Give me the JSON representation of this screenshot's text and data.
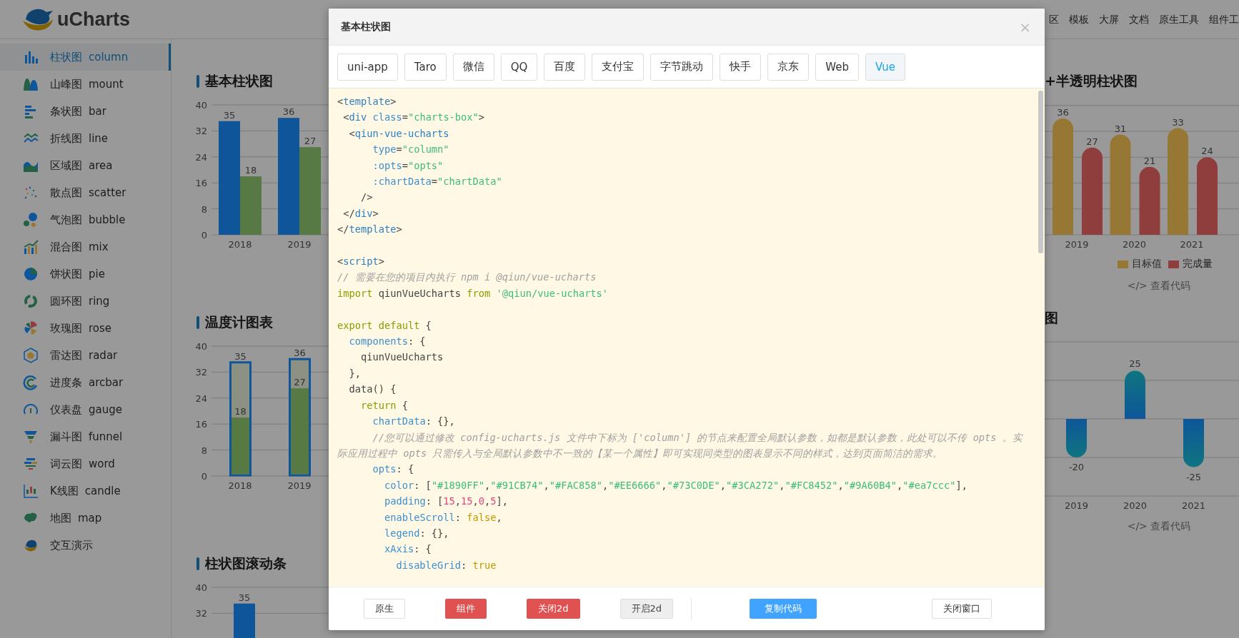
{
  "header": {
    "logo": "uCharts",
    "nav": [
      "区",
      "模板",
      "大屏",
      "文档",
      "原生工具",
      "组件工"
    ]
  },
  "sidebar": {
    "items": [
      {
        "label": "柱状图",
        "en": "column",
        "selected": true
      },
      {
        "label": "山峰图",
        "en": "mount",
        "selected": false
      },
      {
        "label": "条状图",
        "en": "bar",
        "selected": false
      },
      {
        "label": "折线图",
        "en": "line",
        "selected": false
      },
      {
        "label": "区域图",
        "en": "area",
        "selected": false
      },
      {
        "label": "散点图",
        "en": "scatter",
        "selected": false
      },
      {
        "label": "气泡图",
        "en": "bubble",
        "selected": false
      },
      {
        "label": "混合图",
        "en": "mix",
        "selected": false
      },
      {
        "label": "饼状图",
        "en": "pie",
        "selected": false
      },
      {
        "label": "圆环图",
        "en": "ring",
        "selected": false
      },
      {
        "label": "玫瑰图",
        "en": "rose",
        "selected": false
      },
      {
        "label": "雷达图",
        "en": "radar",
        "selected": false
      },
      {
        "label": "进度条",
        "en": "arcbar",
        "selected": false
      },
      {
        "label": "仪表盘",
        "en": "gauge",
        "selected": false
      },
      {
        "label": "漏斗图",
        "en": "funnel",
        "selected": false
      },
      {
        "label": "词云图",
        "en": "word",
        "selected": false
      },
      {
        "label": "K线图",
        "en": "candle",
        "selected": false
      },
      {
        "label": "地图",
        "en": "map",
        "selected": false
      },
      {
        "label": "交互演示",
        "selected": false
      }
    ]
  },
  "charts": {
    "left": [
      {
        "kind": "grouped",
        "title": "基本柱状图",
        "chart_data": {
          "type": "bar",
          "categories": [
            "2018",
            "2019"
          ],
          "series": [
            {
              "color": "#1890FF",
              "values": [
                35,
                36
              ]
            },
            {
              "color": "#91CB74",
              "values": [
                18,
                27
              ]
            }
          ],
          "ylim": [
            0,
            40
          ],
          "yticks": [
            0,
            8,
            16,
            24,
            32,
            40
          ],
          "grid": true,
          "data_labels": true
        }
      },
      {
        "kind": "thermometer",
        "title": "温度计图表",
        "chart_data": {
          "type": "bar",
          "categories": [
            "2018",
            "2019"
          ],
          "series": [
            {
              "color": "#1890FF",
              "values": [
                35,
                36
              ]
            },
            {
              "color": "#91CB74",
              "values": [
                18,
                27
              ]
            }
          ],
          "ylim": [
            0,
            40
          ],
          "yticks": [
            0,
            8,
            16,
            24,
            32,
            40
          ],
          "grid": true,
          "data_labels": true
        }
      },
      {
        "kind": "scroll",
        "title": "柱状图滚动条",
        "chart_data": {
          "type": "bar",
          "series": [
            {
              "color": "#1890FF",
              "values": [
                35
              ]
            }
          ],
          "ylim": [
            0,
            40
          ],
          "yticks": [
            32,
            40
          ],
          "grid": true,
          "data_labels": true
        }
      }
    ],
    "right": [
      {
        "kind": "rounded",
        "title": "+半透明柱状图",
        "chart_data": {
          "type": "bar",
          "categories": [
            "2019",
            "2020",
            "2021"
          ],
          "series": [
            {
              "name": "目标值",
              "color": "#FAC858",
              "values": [
                36,
                31,
                33
              ]
            },
            {
              "name": "完成量",
              "color": "#EE6666",
              "values": [
                27,
                21,
                24
              ]
            }
          ],
          "grid": true,
          "data_labels": true
        },
        "code_link": "</> 查看代码"
      },
      {
        "kind": "diverging",
        "title": "图",
        "chart_data": {
          "type": "bar",
          "categories": [
            "2019",
            "2020",
            "2021"
          ],
          "series": [
            {
              "values": [
                -20,
                25,
                -25
              ]
            }
          ],
          "grid": true,
          "data_labels": true
        },
        "code_link": "</> 查看代码"
      }
    ]
  },
  "dialog": {
    "title": "基本柱状图",
    "close": "×",
    "tabs": [
      {
        "label": "uni-app",
        "selected": false
      },
      {
        "label": "Taro",
        "selected": false
      },
      {
        "label": "微信",
        "selected": false
      },
      {
        "label": "QQ",
        "selected": false
      },
      {
        "label": "百度",
        "selected": false
      },
      {
        "label": "支付宝",
        "selected": false
      },
      {
        "label": "字节跳动",
        "selected": false
      },
      {
        "label": "快手",
        "selected": false
      },
      {
        "label": "京东",
        "selected": false
      },
      {
        "label": "Web",
        "selected": false
      },
      {
        "label": "Vue",
        "selected": true
      }
    ],
    "code": [
      [
        [
          {
            "kind": "p",
            "text": "<"
          },
          {
            "kind": "tag",
            "text": "template"
          },
          {
            "kind": "p",
            "text": ">"
          }
        ],
        [
          {
            "kind": "p",
            "text": " <"
          },
          {
            "kind": "tag",
            "text": "div"
          },
          {
            "kind": "attr",
            "text": " class"
          },
          {
            "kind": "p",
            "text": "="
          },
          {
            "kind": "str",
            "text": "\"charts-box\""
          },
          {
            "kind": "p",
            "text": ">"
          }
        ],
        [
          {
            "kind": "p",
            "text": "  <"
          },
          {
            "kind": "tag",
            "text": "qiun-vue-ucharts"
          }
        ],
        [
          {
            "kind": "attr",
            "text": "      type"
          },
          {
            "kind": "p",
            "text": "="
          },
          {
            "kind": "str",
            "text": "\"column\""
          }
        ],
        [
          {
            "kind": "attr",
            "text": "      :opts"
          },
          {
            "kind": "p",
            "text": "="
          },
          {
            "kind": "str",
            "text": "\"opts\""
          }
        ],
        [
          {
            "kind": "attr",
            "text": "      :chartData"
          },
          {
            "kind": "p",
            "text": "="
          },
          {
            "kind": "str",
            "text": "\"chartData\""
          }
        ],
        [
          {
            "kind": "p",
            "text": "    />"
          }
        ],
        [
          {
            "kind": "p",
            "text": " </"
          },
          {
            "kind": "tag",
            "text": "div"
          },
          {
            "kind": "p",
            "text": ">"
          }
        ],
        [
          {
            "kind": "p",
            "text": "</"
          },
          {
            "kind": "tag",
            "text": "template"
          },
          {
            "kind": "p",
            "text": ">"
          }
        ]
      ],
      [
        [
          {
            "kind": "p",
            "text": "<"
          },
          {
            "kind": "tag",
            "text": "script"
          },
          {
            "kind": "p",
            "text": ">"
          }
        ],
        [
          {
            "kind": "comment",
            "text": "// 需要在您的项目内执行 npm i @qiun/vue-ucharts"
          }
        ],
        [
          {
            "kind": "kw",
            "text": "import"
          },
          {
            "kind": "p",
            "text": " qiunVueUcharts "
          },
          {
            "kind": "kw",
            "text": "from"
          },
          {
            "kind": "str",
            "text": " '@qiun/vue-ucharts'"
          }
        ]
      ],
      [
        [
          {
            "kind": "kw",
            "text": "export default"
          },
          {
            "kind": "p",
            "text": " {"
          }
        ],
        [
          {
            "kind": "key",
            "text": "  components"
          },
          {
            "kind": "p",
            "text": ": {"
          }
        ],
        [
          {
            "kind": "p",
            "text": "    qiunVueUcharts"
          }
        ],
        [
          {
            "kind": "p",
            "text": "  },"
          }
        ],
        [
          {
            "kind": "p",
            "text": "  data() {"
          }
        ],
        [
          {
            "kind": "kw",
            "text": "    return"
          },
          {
            "kind": "p",
            "text": " {"
          }
        ],
        [
          {
            "kind": "key",
            "text": "      chartData"
          },
          {
            "kind": "p",
            "text": ": {},"
          }
        ],
        [
          {
            "kind": "comment",
            "text": "      //您可以通过修改 config-ucharts.js 文件中下标为 ['column'] 的节点来配置全局默认参数，如都是默认参数，此处可以不传 opts 。实际应用过程中 opts 只需传入与全局默认参数中不一致的【某一个属性】即可实现同类型的图表显示不同的样式，达到页面简洁的需求。"
          }
        ],
        [
          {
            "kind": "key",
            "text": "      opts"
          },
          {
            "kind": "p",
            "text": ": {"
          }
        ],
        [
          {
            "kind": "key",
            "text": "        color"
          },
          {
            "kind": "p",
            "text": ": ["
          },
          {
            "kind": "str",
            "text": "\"#1890FF\""
          },
          {
            "kind": "p",
            "text": ","
          },
          {
            "kind": "str",
            "text": "\"#91CB74\""
          },
          {
            "kind": "p",
            "text": ","
          },
          {
            "kind": "str",
            "text": "\"#FAC858\""
          },
          {
            "kind": "p",
            "text": ","
          },
          {
            "kind": "str",
            "text": "\"#EE6666\""
          },
          {
            "kind": "p",
            "text": ","
          },
          {
            "kind": "str",
            "text": "\"#73C0DE\""
          },
          {
            "kind": "p",
            "text": ","
          },
          {
            "kind": "str",
            "text": "\"#3CA272\""
          },
          {
            "kind": "p",
            "text": ","
          },
          {
            "kind": "str",
            "text": "\"#FC8452\""
          },
          {
            "kind": "p",
            "text": ","
          },
          {
            "kind": "str",
            "text": "\"#9A60B4\""
          },
          {
            "kind": "p",
            "text": ","
          },
          {
            "kind": "str",
            "text": "\"#ea7ccc\""
          },
          {
            "kind": "p",
            "text": "],"
          }
        ],
        [
          {
            "kind": "key",
            "text": "        padding"
          },
          {
            "kind": "p",
            "text": ": ["
          },
          {
            "kind": "num",
            "text": "15"
          },
          {
            "kind": "p",
            "text": ","
          },
          {
            "kind": "num",
            "text": "15"
          },
          {
            "kind": "p",
            "text": ","
          },
          {
            "kind": "num",
            "text": "0"
          },
          {
            "kind": "p",
            "text": ","
          },
          {
            "kind": "num",
            "text": "5"
          },
          {
            "kind": "p",
            "text": "],"
          }
        ],
        [
          {
            "kind": "key",
            "text": "        enableScroll"
          },
          {
            "kind": "p",
            "text": ": "
          },
          {
            "kind": "bool",
            "text": "false"
          },
          {
            "kind": "p",
            "text": ","
          }
        ],
        [
          {
            "kind": "key",
            "text": "        legend"
          },
          {
            "kind": "p",
            "text": ": {},"
          }
        ],
        [
          {
            "kind": "key",
            "text": "        xAxis"
          },
          {
            "kind": "p",
            "text": ": {"
          }
        ],
        [
          {
            "kind": "key",
            "text": "          disableGrid"
          },
          {
            "kind": "p",
            "text": ": "
          },
          {
            "kind": "bool",
            "text": "true"
          }
        ]
      ]
    ],
    "buttons": [
      {
        "label": "原生",
        "kind": "default"
      },
      {
        "label": "组件",
        "kind": "danger"
      },
      {
        "label": "关闭2d",
        "kind": "danger"
      },
      {
        "label": "开启2d",
        "kind": "muted"
      },
      {
        "label": "复制代码",
        "kind": "primary"
      },
      {
        "label": "关闭窗口",
        "kind": "default"
      }
    ]
  }
}
